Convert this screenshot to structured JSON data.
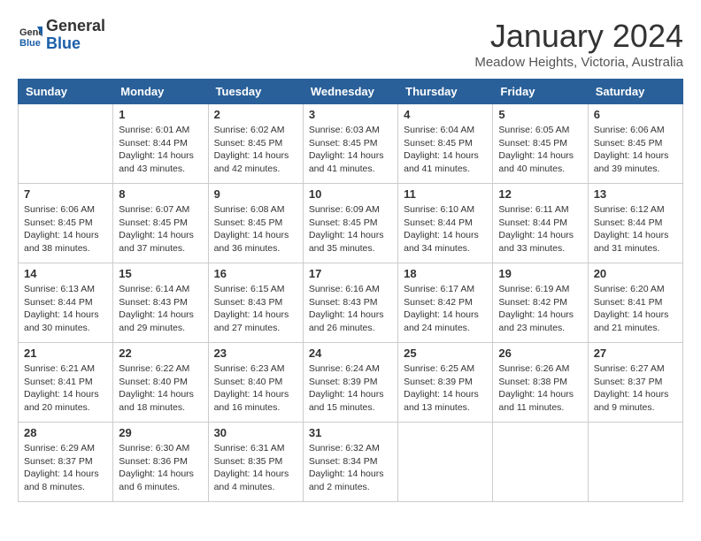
{
  "header": {
    "logo_line1": "General",
    "logo_line2": "Blue",
    "title": "January 2024",
    "subtitle": "Meadow Heights, Victoria, Australia"
  },
  "days_of_week": [
    "Sunday",
    "Monday",
    "Tuesday",
    "Wednesday",
    "Thursday",
    "Friday",
    "Saturday"
  ],
  "weeks": [
    [
      {
        "day": "",
        "info": ""
      },
      {
        "day": "1",
        "info": "Sunrise: 6:01 AM\nSunset: 8:44 PM\nDaylight: 14 hours\nand 43 minutes."
      },
      {
        "day": "2",
        "info": "Sunrise: 6:02 AM\nSunset: 8:45 PM\nDaylight: 14 hours\nand 42 minutes."
      },
      {
        "day": "3",
        "info": "Sunrise: 6:03 AM\nSunset: 8:45 PM\nDaylight: 14 hours\nand 41 minutes."
      },
      {
        "day": "4",
        "info": "Sunrise: 6:04 AM\nSunset: 8:45 PM\nDaylight: 14 hours\nand 41 minutes."
      },
      {
        "day": "5",
        "info": "Sunrise: 6:05 AM\nSunset: 8:45 PM\nDaylight: 14 hours\nand 40 minutes."
      },
      {
        "day": "6",
        "info": "Sunrise: 6:06 AM\nSunset: 8:45 PM\nDaylight: 14 hours\nand 39 minutes."
      }
    ],
    [
      {
        "day": "7",
        "info": "Sunrise: 6:06 AM\nSunset: 8:45 PM\nDaylight: 14 hours\nand 38 minutes."
      },
      {
        "day": "8",
        "info": "Sunrise: 6:07 AM\nSunset: 8:45 PM\nDaylight: 14 hours\nand 37 minutes."
      },
      {
        "day": "9",
        "info": "Sunrise: 6:08 AM\nSunset: 8:45 PM\nDaylight: 14 hours\nand 36 minutes."
      },
      {
        "day": "10",
        "info": "Sunrise: 6:09 AM\nSunset: 8:45 PM\nDaylight: 14 hours\nand 35 minutes."
      },
      {
        "day": "11",
        "info": "Sunrise: 6:10 AM\nSunset: 8:44 PM\nDaylight: 14 hours\nand 34 minutes."
      },
      {
        "day": "12",
        "info": "Sunrise: 6:11 AM\nSunset: 8:44 PM\nDaylight: 14 hours\nand 33 minutes."
      },
      {
        "day": "13",
        "info": "Sunrise: 6:12 AM\nSunset: 8:44 PM\nDaylight: 14 hours\nand 31 minutes."
      }
    ],
    [
      {
        "day": "14",
        "info": "Sunrise: 6:13 AM\nSunset: 8:44 PM\nDaylight: 14 hours\nand 30 minutes."
      },
      {
        "day": "15",
        "info": "Sunrise: 6:14 AM\nSunset: 8:43 PM\nDaylight: 14 hours\nand 29 minutes."
      },
      {
        "day": "16",
        "info": "Sunrise: 6:15 AM\nSunset: 8:43 PM\nDaylight: 14 hours\nand 27 minutes."
      },
      {
        "day": "17",
        "info": "Sunrise: 6:16 AM\nSunset: 8:43 PM\nDaylight: 14 hours\nand 26 minutes."
      },
      {
        "day": "18",
        "info": "Sunrise: 6:17 AM\nSunset: 8:42 PM\nDaylight: 14 hours\nand 24 minutes."
      },
      {
        "day": "19",
        "info": "Sunrise: 6:19 AM\nSunset: 8:42 PM\nDaylight: 14 hours\nand 23 minutes."
      },
      {
        "day": "20",
        "info": "Sunrise: 6:20 AM\nSunset: 8:41 PM\nDaylight: 14 hours\nand 21 minutes."
      }
    ],
    [
      {
        "day": "21",
        "info": "Sunrise: 6:21 AM\nSunset: 8:41 PM\nDaylight: 14 hours\nand 20 minutes."
      },
      {
        "day": "22",
        "info": "Sunrise: 6:22 AM\nSunset: 8:40 PM\nDaylight: 14 hours\nand 18 minutes."
      },
      {
        "day": "23",
        "info": "Sunrise: 6:23 AM\nSunset: 8:40 PM\nDaylight: 14 hours\nand 16 minutes."
      },
      {
        "day": "24",
        "info": "Sunrise: 6:24 AM\nSunset: 8:39 PM\nDaylight: 14 hours\nand 15 minutes."
      },
      {
        "day": "25",
        "info": "Sunrise: 6:25 AM\nSunset: 8:39 PM\nDaylight: 14 hours\nand 13 minutes."
      },
      {
        "day": "26",
        "info": "Sunrise: 6:26 AM\nSunset: 8:38 PM\nDaylight: 14 hours\nand 11 minutes."
      },
      {
        "day": "27",
        "info": "Sunrise: 6:27 AM\nSunset: 8:37 PM\nDaylight: 14 hours\nand 9 minutes."
      }
    ],
    [
      {
        "day": "28",
        "info": "Sunrise: 6:29 AM\nSunset: 8:37 PM\nDaylight: 14 hours\nand 8 minutes."
      },
      {
        "day": "29",
        "info": "Sunrise: 6:30 AM\nSunset: 8:36 PM\nDaylight: 14 hours\nand 6 minutes."
      },
      {
        "day": "30",
        "info": "Sunrise: 6:31 AM\nSunset: 8:35 PM\nDaylight: 14 hours\nand 4 minutes."
      },
      {
        "day": "31",
        "info": "Sunrise: 6:32 AM\nSunset: 8:34 PM\nDaylight: 14 hours\nand 2 minutes."
      },
      {
        "day": "",
        "info": ""
      },
      {
        "day": "",
        "info": ""
      },
      {
        "day": "",
        "info": ""
      }
    ]
  ]
}
